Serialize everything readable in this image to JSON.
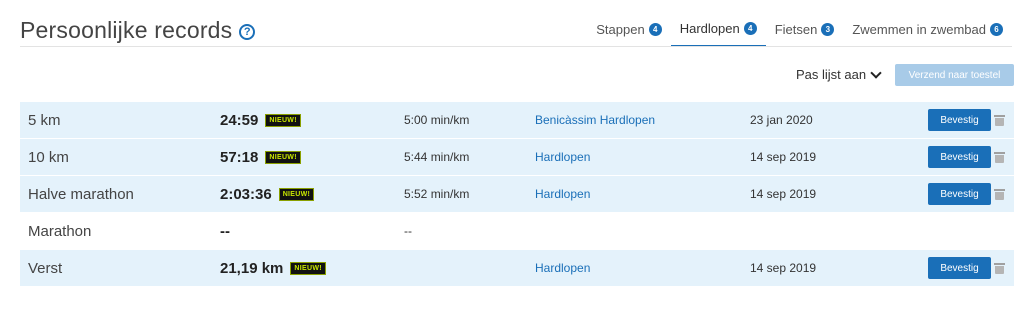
{
  "header": {
    "title": "Persoonlijke records",
    "help_icon": "?"
  },
  "tabs": [
    {
      "label": "Stappen",
      "count": "4",
      "active": false
    },
    {
      "label": "Hardlopen",
      "count": "4",
      "active": true
    },
    {
      "label": "Fietsen",
      "count": "3",
      "active": false
    },
    {
      "label": "Zwemmen in zwembad",
      "count": "6",
      "active": false
    }
  ],
  "toolbar": {
    "customize_label": "Pas lijst aan",
    "send_label": "Verzend naar toestel"
  },
  "records": [
    {
      "name": "5 km",
      "value": "24:59",
      "badge": "NIEUW!",
      "pace": "5:00 min/km",
      "activity": "Benicàssim Hardlopen",
      "date": "23 jan 2020",
      "button": "Bevestig",
      "highlight": true
    },
    {
      "name": "10 km",
      "value": "57:18",
      "badge": "NIEUW!",
      "pace": "5:44 min/km",
      "activity": "Hardlopen",
      "date": "14 sep 2019",
      "button": "Bevestig",
      "highlight": true
    },
    {
      "name": "Halve marathon",
      "value": "2:03:36",
      "badge": "NIEUW!",
      "pace": "5:52 min/km",
      "activity": "Hardlopen",
      "date": "14 sep 2019",
      "button": "Bevestig",
      "highlight": true
    },
    {
      "name": "Marathon",
      "value": "--",
      "badge": "",
      "pace": "--",
      "activity": "",
      "date": "",
      "button": "",
      "highlight": false
    },
    {
      "name": "Verst",
      "value": "21,19 km",
      "badge": "NIEUW!",
      "pace": "",
      "activity": "Hardlopen",
      "date": "14 sep 2019",
      "button": "Bevestig",
      "highlight": true
    }
  ],
  "colors": {
    "accent": "#1a6fb8",
    "row_highlight": "#e4f2fb",
    "disabled_button": "#a8cbe8",
    "new_badge_text": "#c8e600"
  }
}
